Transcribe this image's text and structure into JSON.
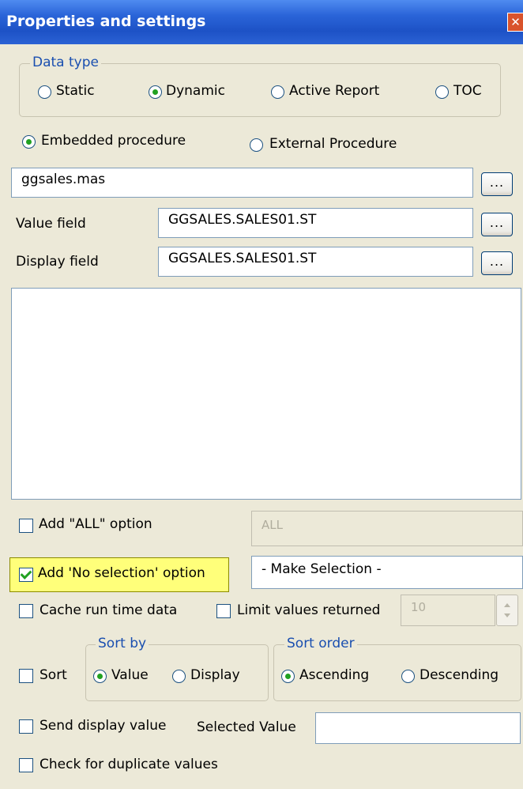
{
  "window": {
    "title": "Properties and settings",
    "close_symbol": "✕"
  },
  "data_type": {
    "legend": "Data type",
    "options": [
      "Static",
      "Dynamic",
      "Active Report",
      "TOC"
    ],
    "selected": "Dynamic"
  },
  "procedure": {
    "options": [
      "Embedded procedure",
      "External Procedure"
    ],
    "selected": "Embedded procedure",
    "file_value": "ggsales.mas"
  },
  "fields": {
    "value_label": "Value field",
    "value": "GGSALES.SALES01.ST",
    "display_label": "Display field",
    "display": "GGSALES.SALES01.ST",
    "ellipsis": "..."
  },
  "options": {
    "add_all_label": "Add \"ALL\" option",
    "add_all_checked": false,
    "add_all_value": "ALL",
    "no_selection_label": "Add 'No selection' option",
    "no_selection_checked": true,
    "no_selection_value": "- Make Selection -",
    "cache_label": "Cache run time data",
    "cache_checked": false,
    "limit_label": "Limit values returned",
    "limit_checked": false,
    "limit_value": "10"
  },
  "sort": {
    "sort_label": "Sort",
    "sort_checked": false,
    "sort_by_legend": "Sort by",
    "sort_by_options": [
      "Value",
      "Display"
    ],
    "sort_by_selected": "Value",
    "sort_order_legend": "Sort order",
    "sort_order_options": [
      "Ascending",
      "Descending"
    ],
    "sort_order_selected": "Ascending"
  },
  "footer": {
    "send_display_label": "Send display value",
    "send_display_checked": false,
    "selected_value_label": "Selected Value",
    "selected_value": "",
    "duplicates_label": "Check for duplicate values",
    "duplicates_checked": false
  }
}
